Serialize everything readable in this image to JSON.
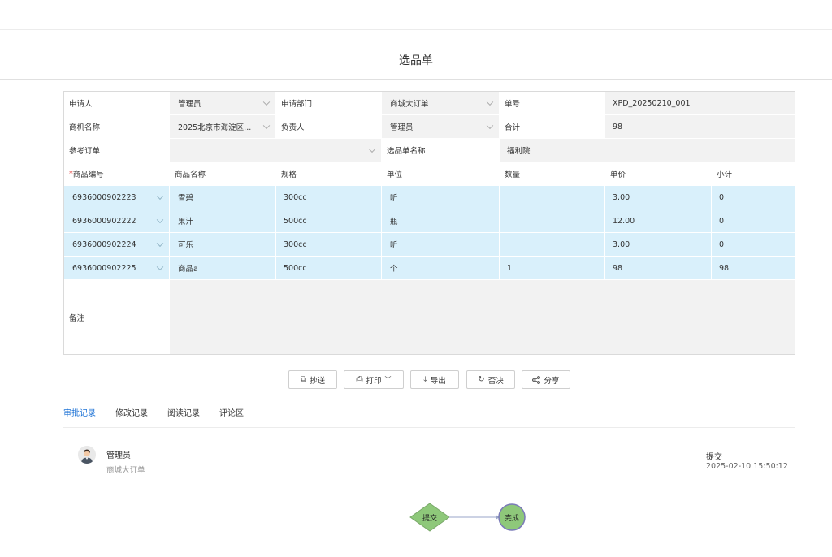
{
  "page": {
    "title": "选品单"
  },
  "form": {
    "applicant_label": "申请人",
    "applicant_value": "管理员",
    "dept_label": "申请部门",
    "dept_value": "商城大订单",
    "order_no_label": "单号",
    "order_no_value": "XPD_20250210_001",
    "opportunity_label": "商机名称",
    "opportunity_value": "2025北京市海淀区...",
    "owner_label": "负责人",
    "owner_value": "管理员",
    "total_label": "合计",
    "total_value": "98",
    "ref_order_label": "参考订单",
    "ref_order_value": "",
    "selection_name_label": "选品单名称",
    "selection_name_value": "福利院",
    "remark_label": "备注",
    "remark_value": ""
  },
  "table": {
    "required_mark": "*",
    "headers": [
      "商品编号",
      "商品名称",
      "规格",
      "单位",
      "数量",
      "单价",
      "小计"
    ],
    "rows": [
      {
        "code": "6936000902223",
        "name": "雪碧",
        "spec": "300cc",
        "unit": "听",
        "qty": "",
        "price": "3.00",
        "subtotal": "0"
      },
      {
        "code": "6936000902222",
        "name": "果汁",
        "spec": "500cc",
        "unit": "瓶",
        "qty": "",
        "price": "12.00",
        "subtotal": "0"
      },
      {
        "code": "6936000902224",
        "name": "可乐",
        "spec": "300cc",
        "unit": "听",
        "qty": "",
        "price": "3.00",
        "subtotal": "0"
      },
      {
        "code": "6936000902225",
        "name": "商品a",
        "spec": "500cc",
        "unit": "个",
        "qty": "1",
        "price": "98",
        "subtotal": "98"
      }
    ]
  },
  "toolbar": {
    "copy_label": "抄送",
    "print_label": "打印",
    "export_label": "导出",
    "reject_label": "否决",
    "share_label": "分享"
  },
  "tabs": [
    "审批记录",
    "修改记录",
    "阅读记录",
    "评论区"
  ],
  "record": {
    "name": "管理员",
    "dept": "商城大订单",
    "action": "提交",
    "time": "2025-02-10 15:50:12"
  },
  "flow": {
    "start_label": "提交",
    "end_label": "完成",
    "start_color": "#8ec87a",
    "end_color": "#8ec87a",
    "end_stroke": "#7a7ab8"
  },
  "colors": {
    "accent": "#1e73d6",
    "row_highlight": "#d9f0fb",
    "required": "#e53935"
  }
}
